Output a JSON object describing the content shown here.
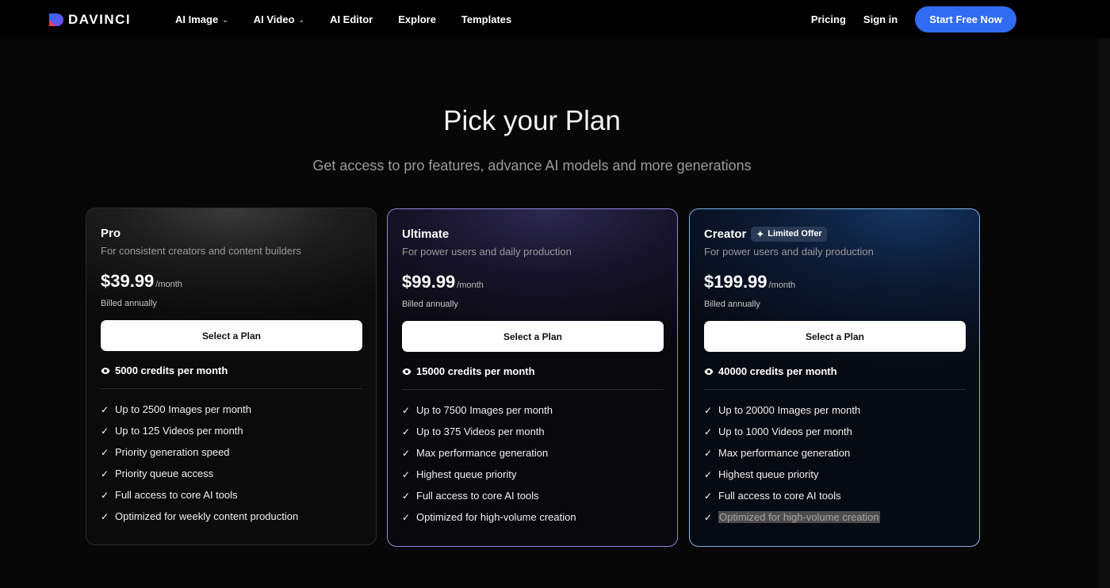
{
  "brand": {
    "name": "DAVINCI"
  },
  "nav": {
    "items": [
      {
        "label": "AI Image",
        "dropdown": true
      },
      {
        "label": "AI Video",
        "dropdown": true
      },
      {
        "label": "AI Editor",
        "dropdown": false
      },
      {
        "label": "Explore",
        "dropdown": false
      },
      {
        "label": "Templates",
        "dropdown": false
      }
    ],
    "pricing": "Pricing",
    "signin": "Sign in",
    "cta": "Start Free Now"
  },
  "hero": {
    "title": "Pick your Plan",
    "subtitle": "Get access to pro features, advance AI models and more generations"
  },
  "plans": [
    {
      "name": "Pro",
      "badge": "",
      "description": "For consistent creators and content builders",
      "price": "$39.99",
      "period": "/month",
      "billing": "Billed annually",
      "button": "Select a Plan",
      "credits": "5000 credits per month",
      "features": [
        "Up to 2500 Images per month",
        "Up to 125 Videos per month",
        "Priority generation speed",
        "Priority queue access",
        "Full access to core AI tools",
        "Optimized for weekly content production"
      ]
    },
    {
      "name": "Ultimate",
      "badge": "",
      "description": "For power users and daily production",
      "price": "$99.99",
      "period": "/month",
      "billing": "Billed annually",
      "button": "Select a Plan",
      "credits": "15000 credits per month",
      "features": [
        "Up to 7500 Images per month",
        "Up to 375 Videos per month",
        "Max performance generation",
        "Highest queue priority",
        "Full access to core AI tools",
        "Optimized for high-volume creation"
      ]
    },
    {
      "name": "Creator",
      "badge": "Limited Offer",
      "description": "For power users and daily production",
      "price": "$199.99",
      "period": "/month",
      "billing": "Billed annually",
      "button": "Select a Plan",
      "credits": "40000 credits per month",
      "features": [
        "Up to 20000 Images per month",
        "Up to 1000 Videos per month",
        "Max performance generation",
        "Highest queue priority",
        "Full access to core AI tools",
        "Optimized for high-volume creation"
      ]
    }
  ],
  "colors": {
    "background": "#070707",
    "cta": "#2f6cf3",
    "ultimate_border": "#8f8ad8",
    "creator_border": "#7fb2e6"
  }
}
